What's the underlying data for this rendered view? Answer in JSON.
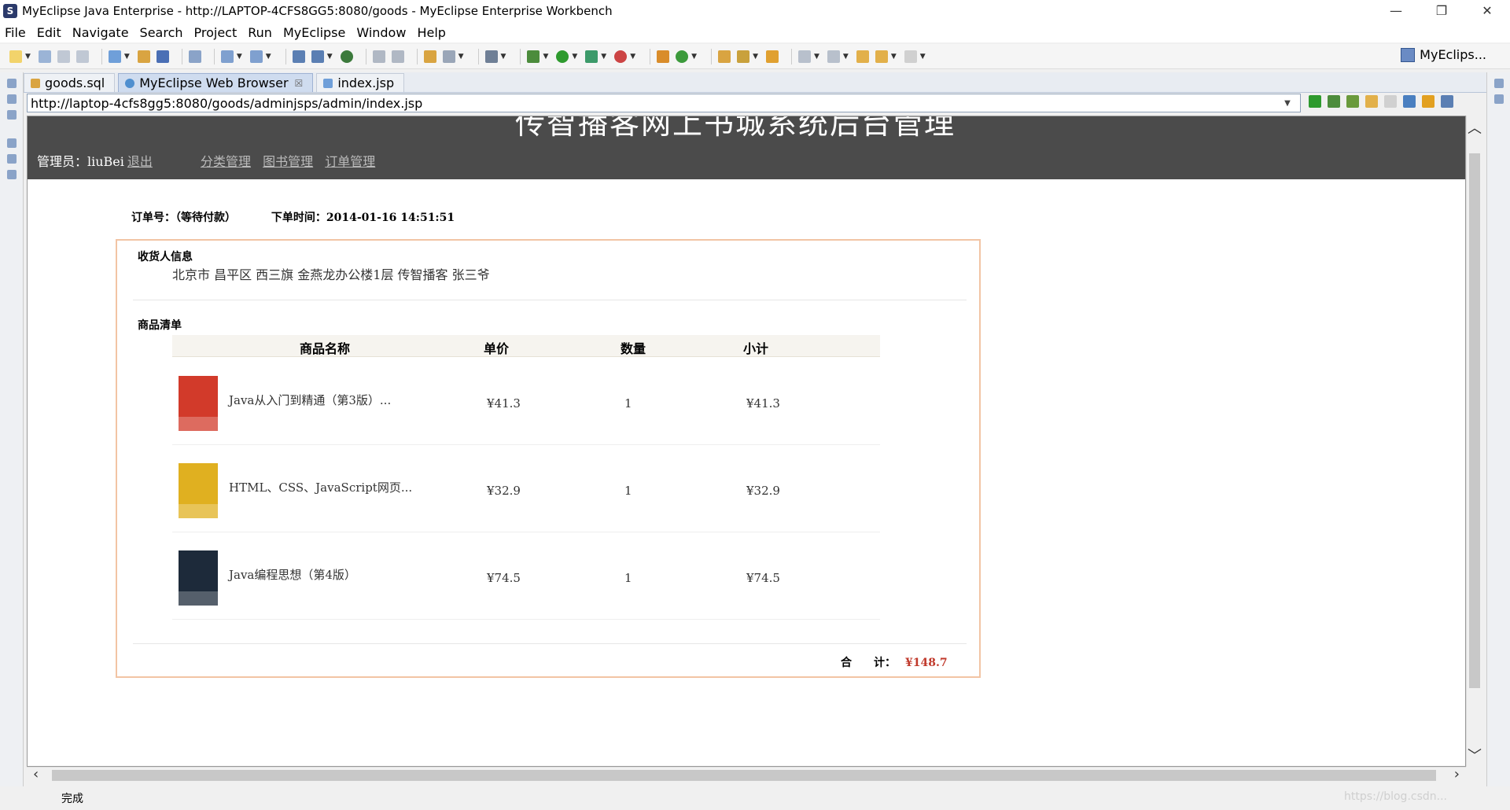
{
  "window": {
    "title": "MyEclipse Java Enterprise - http://LAPTOP-4CFS8GG5:8080/goods - MyEclipse Enterprise Workbench",
    "minimize": "—",
    "restore": "❐",
    "close": "✕"
  },
  "menu": [
    "File",
    "Edit",
    "Navigate",
    "Search",
    "Project",
    "Run",
    "MyEclipse",
    "Window",
    "Help"
  ],
  "perspective": "MyEclips...",
  "tabs": [
    {
      "label": "goods.sql"
    },
    {
      "label": "MyEclipse Web Browser",
      "close": "☒"
    },
    {
      "label": "index.jsp"
    }
  ],
  "browser": {
    "url": "http://laptop-4cfs8gg5:8080/goods/adminjsps/admin/index.jsp",
    "status": "完成"
  },
  "page": {
    "site_title": "传智播客网上书城系统后台管理",
    "admin_label": "管理员：liuBei",
    "logout": "退出",
    "nav": [
      "分类管理",
      "图书管理",
      "订单管理"
    ],
    "order_no_label": "订单号：（等待付款）",
    "order_time_label": "下单时间：2014-01-16 14:51:51",
    "receiver_title": "收货人信息",
    "receiver_address": "北京市  昌平区  西三旗  金燕龙办公楼1层  传智播客  张三爷",
    "goods_title": "商品清单",
    "table_headers": [
      "商品名称",
      "单价",
      "数量",
      "小计"
    ],
    "items": [
      {
        "name": "Java从入门到精通（第3版）...",
        "price": "¥41.3",
        "qty": "1",
        "subtotal": "¥41.3",
        "cover_color": "#d23a2a"
      },
      {
        "name": "HTML、CSS、JavaScript网页...",
        "price": "¥32.9",
        "qty": "1",
        "subtotal": "¥32.9",
        "cover_color": "#e0b020"
      },
      {
        "name": "Java编程思想（第4版）",
        "price": "¥74.5",
        "qty": "1",
        "subtotal": "¥74.5",
        "cover_color": "#1d2a3a"
      }
    ],
    "total_label": "合　　计：",
    "total_amount": "¥148.7"
  },
  "watermark": "https://blog.csdn..."
}
